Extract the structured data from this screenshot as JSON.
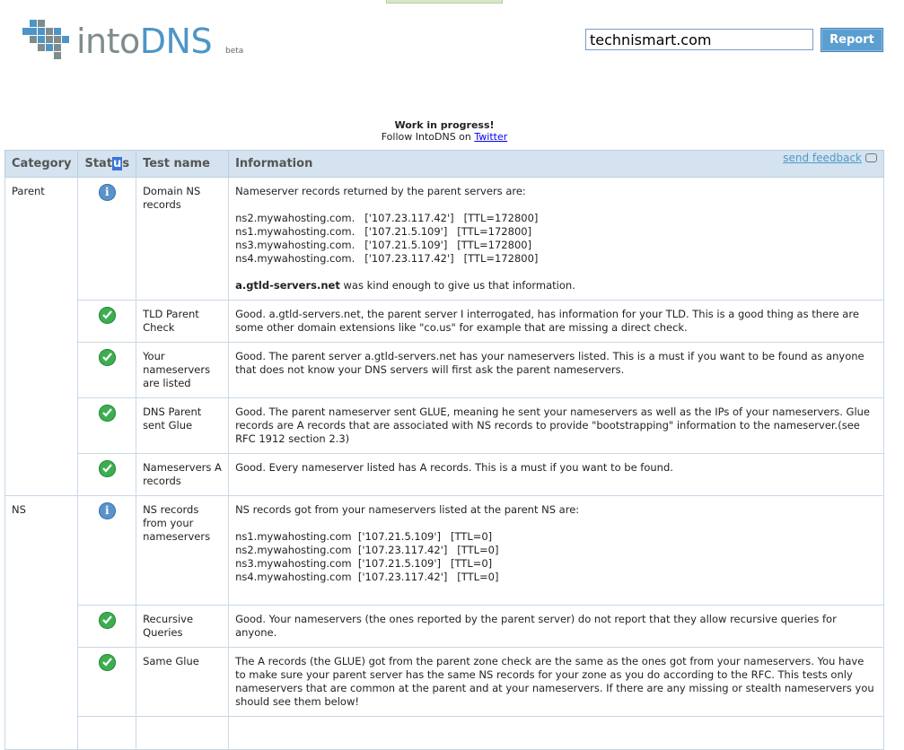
{
  "logo": {
    "into": "into",
    "dns": "DNS",
    "beta": "beta"
  },
  "search": {
    "value": "technismart.com"
  },
  "report_label": "Report",
  "notice": {
    "title": "Work in progress!",
    "follow_prefix": "Follow IntoDNS on ",
    "follow_link": "Twitter"
  },
  "table": {
    "headers": {
      "category": "Category",
      "status_a": "Stat",
      "status_b": "u",
      "status_c": "s",
      "test": "Test name",
      "info": "Information",
      "feedback": "send feedback"
    },
    "rows": [
      {
        "category": "Parent",
        "status": "info",
        "test": "Domain NS records",
        "intro": "Nameserver records returned by the parent servers are:",
        "records": [
          "ns2.mywahosting.com.   ['107.23.117.42']   [TTL=172800]",
          "ns1.mywahosting.com.   ['107.21.5.109']   [TTL=172800]",
          "ns3.mywahosting.com.   ['107.21.5.109']   [TTL=172800]",
          "ns4.mywahosting.com.   ['107.23.117.42']   [TTL=172800]"
        ],
        "outro_bold": "a.gtld-servers.net",
        "outro_rest": " was kind enough to give us that information."
      },
      {
        "status": "ok",
        "test": "TLD Parent Check",
        "info": "Good. a.gtld-servers.net, the parent server I interrogated, has information for your TLD. This is a good thing as there are some other domain extensions like \"co.us\" for example that are missing a direct check."
      },
      {
        "status": "ok",
        "test": "Your nameservers are listed",
        "info": "Good. The parent server a.gtld-servers.net has your nameservers listed. This is a must if you want to be found as anyone that does not know your DNS servers will first ask the parent nameservers."
      },
      {
        "status": "ok",
        "test": "DNS Parent sent Glue",
        "info": "Good. The parent nameserver sent GLUE, meaning he sent your nameservers as well as the IPs of your nameservers. Glue records are A records that are associated with NS records to provide \"bootstrapping\" information to the nameserver.(see RFC 1912 section 2.3)"
      },
      {
        "status": "ok",
        "test": "Nameservers A records",
        "info": "Good. Every nameserver listed has A records. This is a must if you want to be found."
      },
      {
        "category": "NS",
        "status": "info",
        "test": "NS records from your nameservers",
        "intro": "NS records got from your nameservers listed at the parent NS are:",
        "records": [
          "ns1.mywahosting.com  ['107.21.5.109']   [TTL=0]",
          "ns2.mywahosting.com  ['107.23.117.42']   [TTL=0]",
          "ns3.mywahosting.com  ['107.21.5.109']   [TTL=0]",
          "ns4.mywahosting.com  ['107.23.117.42']   [TTL=0]"
        ]
      },
      {
        "status": "ok",
        "test": "Recursive Queries",
        "info": "Good. Your nameservers (the ones reported by the parent server) do not report that they allow recursive queries for anyone."
      },
      {
        "status": "ok",
        "test": "Same Glue",
        "info": "The A records (the GLUE) got from the parent zone check are the same as the ones got from your nameservers. You have to make sure your parent server has the same NS records for your zone as you do according to the RFC. This tests only nameservers that are common at the parent and at your nameservers. If there are any missing or stealth nameservers you should see them below!"
      }
    ]
  },
  "colors": {
    "header_bg": "#d4e3ef",
    "accent": "#5b9ed0",
    "ok_icon": "#3dae4f",
    "info_icon": "#5a93c9"
  },
  "icons": {
    "info": "info-icon",
    "ok": "checkmark-icon",
    "feedback": "speech-bubble-icon"
  }
}
